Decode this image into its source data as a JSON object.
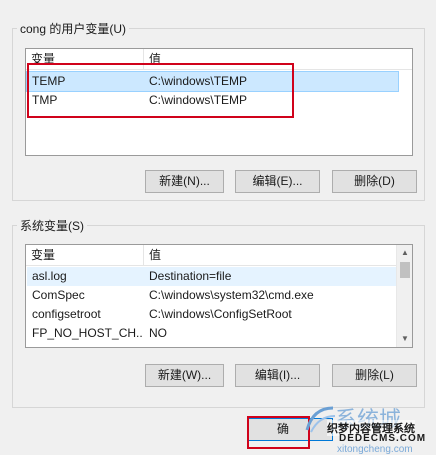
{
  "user_vars": {
    "title": "cong 的用户变量(U)",
    "col_name": "变量",
    "col_value": "值",
    "rows": [
      {
        "name": "TEMP",
        "value": "C:\\windows\\TEMP"
      },
      {
        "name": "TMP",
        "value": "C:\\windows\\TEMP"
      }
    ],
    "new_label": "新建(N)...",
    "edit_label": "编辑(E)...",
    "delete_label": "删除(D)"
  },
  "system_vars": {
    "title": "系统变量(S)",
    "col_name": "变量",
    "col_value": "值",
    "rows": [
      {
        "name": "asl.log",
        "value": "Destination=file"
      },
      {
        "name": "ComSpec",
        "value": "C:\\windows\\system32\\cmd.exe"
      },
      {
        "name": "configsetroot",
        "value": "C:\\windows\\ConfigSetRoot"
      },
      {
        "name": "FP_NO_HOST_CH...",
        "value": "NO"
      }
    ],
    "new_label": "新建(W)...",
    "edit_label": "编辑(I)...",
    "delete_label": "删除(L)"
  },
  "footer": {
    "ok_label": "确"
  },
  "watermark": {
    "brand": "系统城",
    "url": "xitongcheng.com",
    "cms_name": "织梦内容管理系统",
    "cms_url": "DEDECMS.COM"
  },
  "colors": {
    "highlight_box": "#d0021b",
    "selection": "#cce8ff",
    "accent": "#0078d7"
  }
}
